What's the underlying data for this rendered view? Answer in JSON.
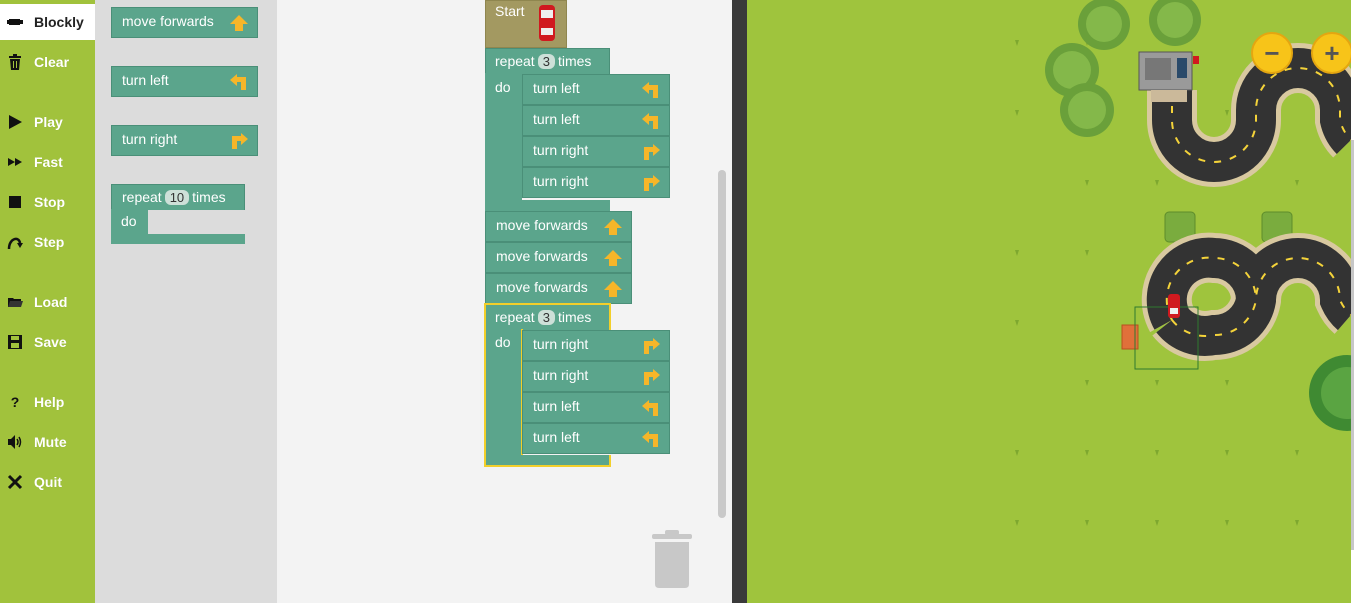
{
  "sidebar": {
    "items": [
      {
        "label": "Blockly",
        "icon": "blockly-icon"
      },
      {
        "label": "Clear",
        "icon": "trash-icon"
      },
      {
        "label": "Play",
        "icon": "play-icon"
      },
      {
        "label": "Fast",
        "icon": "fast-forward-icon"
      },
      {
        "label": "Stop",
        "icon": "stop-icon"
      },
      {
        "label": "Step",
        "icon": "step-icon"
      },
      {
        "label": "Load",
        "icon": "folder-icon"
      },
      {
        "label": "Save",
        "icon": "save-icon"
      },
      {
        "label": "Help",
        "icon": "help-icon"
      },
      {
        "label": "Mute",
        "icon": "speaker-icon"
      },
      {
        "label": "Quit",
        "icon": "close-icon"
      }
    ]
  },
  "toolbox": {
    "move_forwards": "move forwards",
    "turn_left": "turn left",
    "turn_right": "turn right",
    "repeat_prefix": "repeat",
    "repeat_count": "10",
    "repeat_suffix": "times",
    "do": "do"
  },
  "program": {
    "start": "Start",
    "repeat1": {
      "prefix": "repeat",
      "count": "3",
      "suffix": "times",
      "do": "do",
      "body": [
        "turn left",
        "turn left",
        "turn right",
        "turn right"
      ]
    },
    "moves": [
      "move forwards",
      "move forwards",
      "move forwards"
    ],
    "repeat2": {
      "prefix": "repeat",
      "count": "3",
      "suffix": "times",
      "do": "do",
      "body": [
        "turn right",
        "turn right",
        "turn left",
        "turn left"
      ]
    }
  },
  "map": {
    "zoom_out": "−",
    "zoom_in": "+"
  },
  "colors": {
    "sidebar": "#a1c23c",
    "block": "#5ba58c",
    "start_block": "#a39961",
    "grass": "#9fc43d",
    "highlight": "#f2cf2a"
  }
}
